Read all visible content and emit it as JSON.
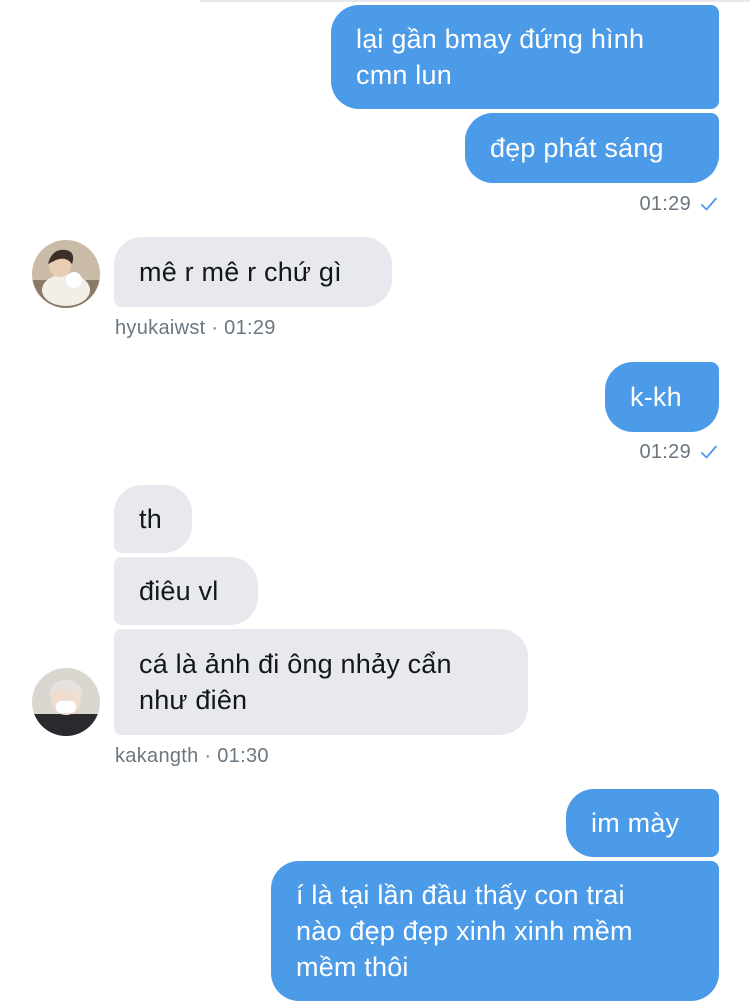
{
  "colors": {
    "outgoing_bubble": "#4c9be8",
    "incoming_bubble": "#e7e9ee",
    "meta_text": "#6b7780",
    "read_check": "#4c9be8"
  },
  "messages": {
    "out_1": "lại gần bmay đứng hình\ncmn lun",
    "out_2": "đẹp phát sáng",
    "time_1": "01:29",
    "in_1": "mê r mê r chứ gì",
    "sender_1": "hyukaiwst · 01:29",
    "out_3": "k-kh",
    "time_2": "01:29",
    "in_2": "th",
    "in_3": "điêu vl",
    "in_4": "cá là ảnh đi ông nhảy cẩn\nnhư điên",
    "sender_2": "kakangth · 01:30",
    "out_4": "im mày",
    "out_5": "í là tại lần đầu thấy con trai\nnào đẹp đẹp xinh xinh mềm\nmềm thôi"
  },
  "icons": {
    "read_receipt": "checkmark-icon",
    "avatar_1": "user-avatar-hyukaiwst",
    "avatar_2": "user-avatar-kakangth"
  }
}
